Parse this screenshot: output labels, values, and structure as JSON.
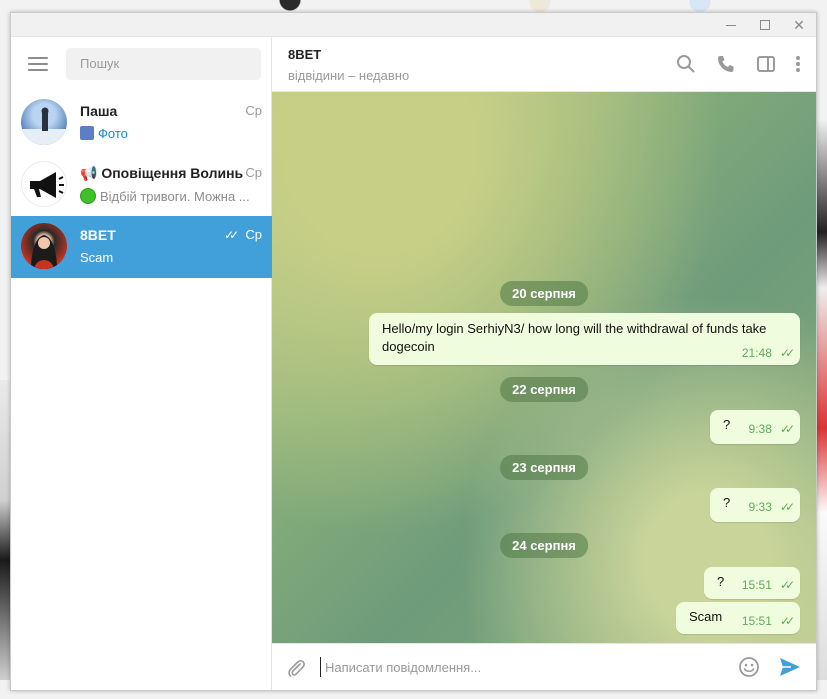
{
  "window": {
    "controls": [
      "minimize",
      "maximize",
      "close"
    ]
  },
  "sidebar": {
    "search_placeholder": "Пошук",
    "chats": [
      {
        "name": "Паша",
        "time": "Ср",
        "preview": "Фото",
        "preview_icon": "photo-icon",
        "active": false
      },
      {
        "name": "📢 Оповіщення Волинь",
        "time": "Ср",
        "preview": "Відбій тривоги. Можна ...",
        "preview_icon": "green-circle-icon",
        "active": false
      },
      {
        "name": "8BET",
        "time": "Ср",
        "preview": "Scam",
        "read_checks": "✓✓",
        "active": true
      }
    ]
  },
  "chat": {
    "title": "8BET",
    "status": "відвідини – недавно",
    "messages": [
      {
        "type": "date",
        "text": "20 серпня"
      },
      {
        "type": "out",
        "text": "Hello/my login SerhiyN3/ how long will the withdrawal of funds take dogecoin",
        "time": "21:48",
        "checks": "✓✓"
      },
      {
        "type": "date",
        "text": "22 серпня"
      },
      {
        "type": "out",
        "text": "?",
        "time": "9:38",
        "checks": "✓✓"
      },
      {
        "type": "date",
        "text": "23 серпня"
      },
      {
        "type": "out",
        "text": "?",
        "time": "9:33",
        "checks": "✓✓"
      },
      {
        "type": "date",
        "text": "24 серпня"
      },
      {
        "type": "out",
        "text": "?",
        "time": "15:51",
        "checks": "✓✓"
      },
      {
        "type": "out",
        "text": "Scam",
        "time": "15:51",
        "checks": "✓✓"
      }
    ],
    "composer_placeholder": "Написати повідомлення..."
  },
  "colors": {
    "accent": "#419fd9",
    "bubble_out": "#effdde",
    "read_check": "#5fab5a"
  }
}
